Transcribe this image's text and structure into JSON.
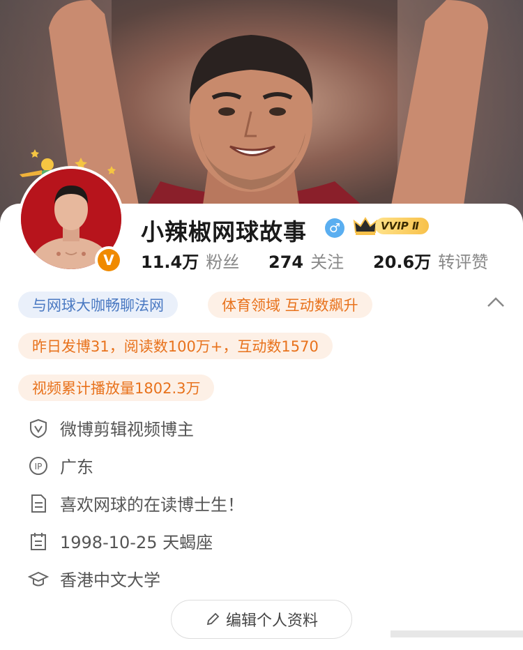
{
  "profile": {
    "name": "小辣椒网球故事",
    "gender_symbol": "♂",
    "vip_label": "VVIP Ⅱ",
    "verified_badge": "V",
    "stats": [
      {
        "value": "11.4万",
        "label": "粉丝"
      },
      {
        "value": "274",
        "label": "关注"
      },
      {
        "value": "20.6万",
        "label": "转评赞"
      }
    ]
  },
  "tags": {
    "intro": "与网球大咖畅聊法网",
    "field": "体育领域 互动数飙升",
    "yesterday": "昨日发博31，阅读数100万+，互动数1570",
    "video": "视频累计播放量1802.3万"
  },
  "info": [
    {
      "icon": "shield-v-icon",
      "text": "微博剪辑视频博主"
    },
    {
      "icon": "ip-location-icon",
      "text": "广东"
    },
    {
      "icon": "document-icon",
      "text": "喜欢网球的在读博士生！"
    },
    {
      "icon": "calendar-icon",
      "text": "1998-10-25 天蝎座"
    },
    {
      "icon": "graduation-cap-icon",
      "text": "香港中文大学"
    }
  ],
  "edit_button": "编辑个人资料",
  "colors": {
    "orange_tag_text": "#e8721c",
    "blue_tag_text": "#4a79c2",
    "verified_orange": "#f08a00",
    "gender_blue": "#5aaef0",
    "avatar_bg": "#b7141c"
  }
}
